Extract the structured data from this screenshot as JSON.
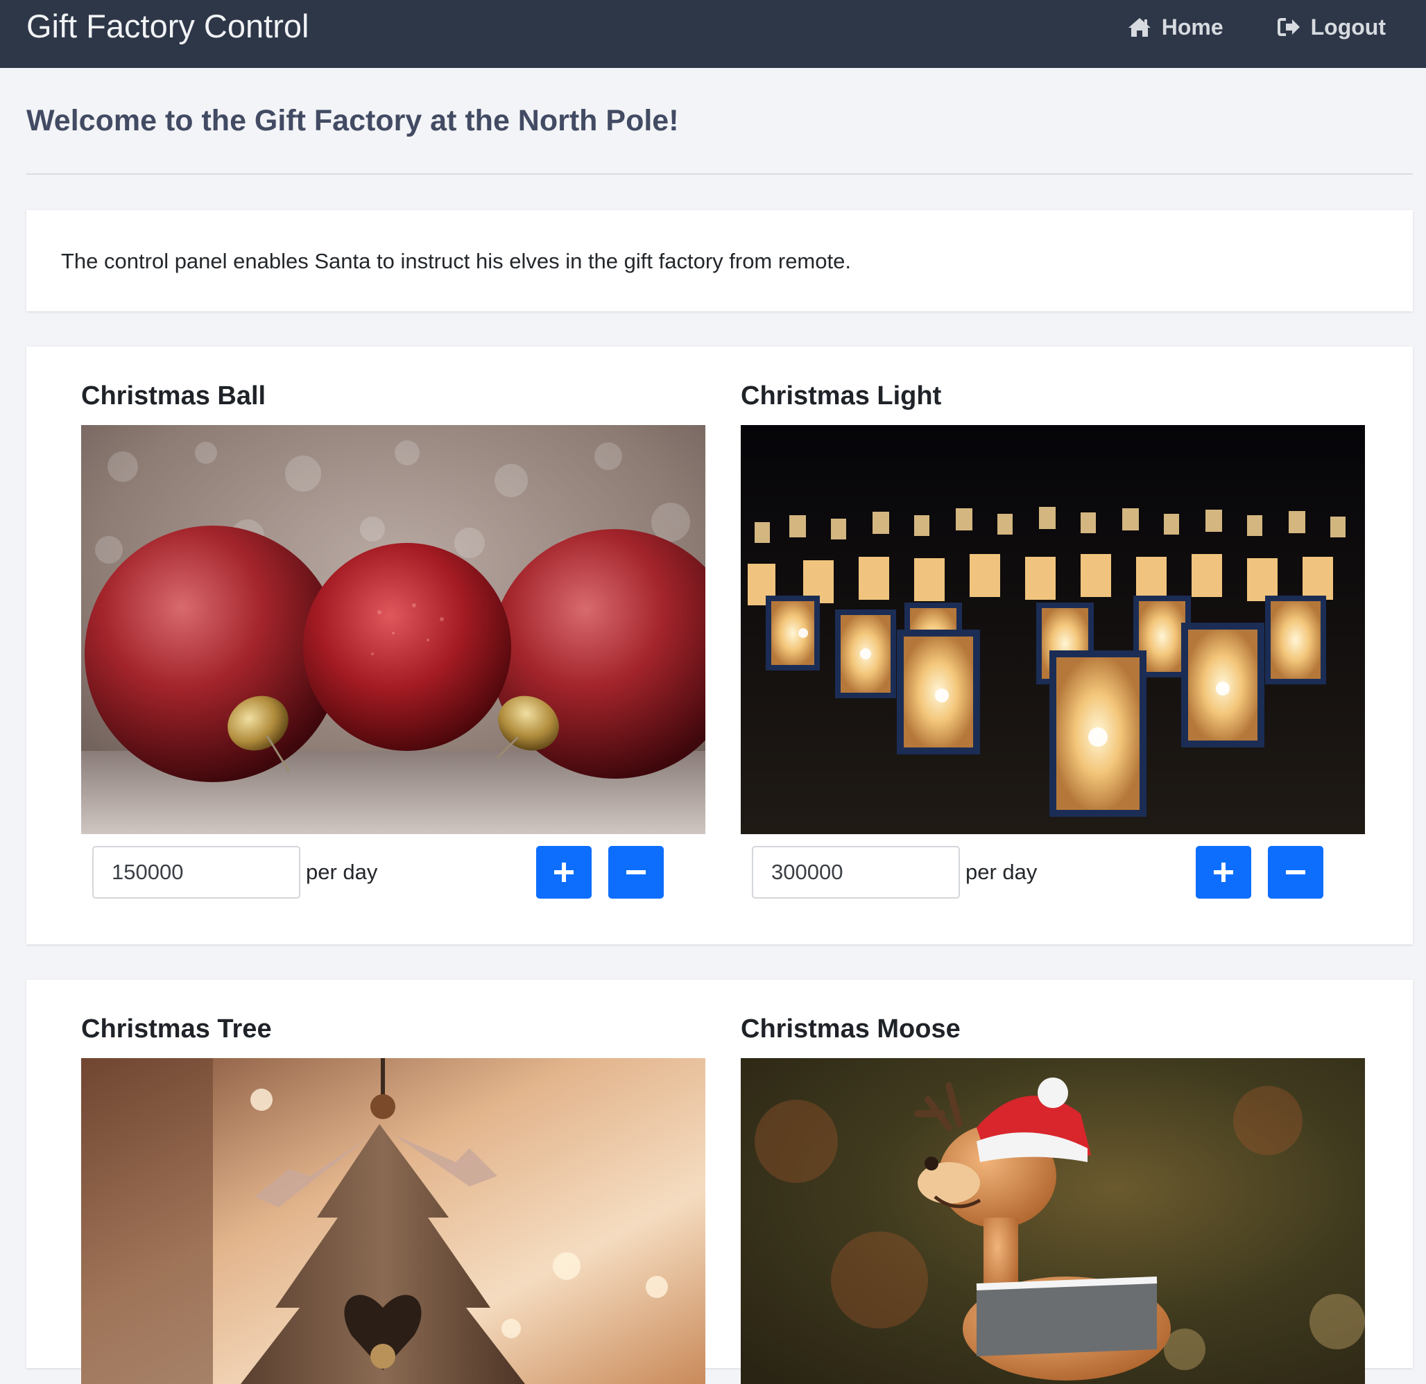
{
  "header": {
    "brand": "Gift Factory Control",
    "nav": [
      {
        "label": "Home",
        "icon": "home-icon"
      },
      {
        "label": "Logout",
        "icon": "logout-icon"
      }
    ]
  },
  "page": {
    "title": "Welcome to the Gift Factory at the North Pole!",
    "intro": "The control panel enables Santa to instruct his elves in the gift factory from remote."
  },
  "products": [
    {
      "name": "Christmas Ball",
      "quantity": "150000",
      "unit": "per day",
      "image": "christmas-balls-photo"
    },
    {
      "name": "Christmas Light",
      "quantity": "300000",
      "unit": "per day",
      "image": "christmas-lanterns-photo"
    },
    {
      "name": "Christmas Tree",
      "image": "wooden-tree-ornament-photo"
    },
    {
      "name": "Christmas Moose",
      "image": "reindeer-figurine-photo"
    }
  ],
  "colors": {
    "navbar": "#2e3748",
    "background": "#f3f4f7",
    "button": "#0d6efd",
    "title": "#424b63"
  }
}
